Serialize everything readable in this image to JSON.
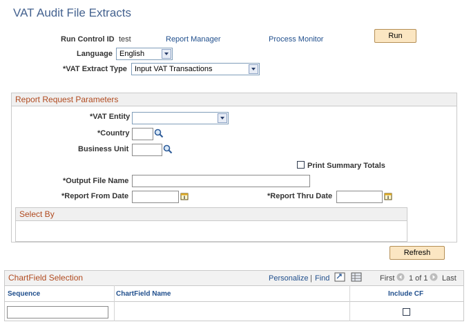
{
  "page": {
    "title": "VAT Audit File Extracts"
  },
  "header": {
    "run_control_label": "Run Control ID",
    "run_control_value": "test",
    "report_manager": "Report Manager",
    "process_monitor": "Process Monitor",
    "run_label": "Run",
    "language_label": "Language",
    "language_value": "English",
    "extract_type_label": "*VAT Extract Type",
    "extract_type_value": "Input VAT Transactions"
  },
  "params": {
    "title": "Report Request Parameters",
    "vat_entity_label": "*VAT Entity",
    "vat_entity_value": "",
    "country_label": "*Country",
    "business_unit_label": "Business Unit",
    "print_summary_label": "Print Summary Totals",
    "print_summary_checked": false,
    "output_file_label": "*Output File Name",
    "from_date_label": "*Report From Date",
    "thru_date_label": "*Report Thru Date",
    "select_by_title": "Select By",
    "refresh_label": "Refresh"
  },
  "chartfield": {
    "title": "ChartField Selection",
    "personalize": "Personalize",
    "separator": "|",
    "find": "Find",
    "first": "First",
    "page_info": "1 of 1",
    "last": "Last",
    "columns": [
      "Sequence",
      "ChartField Name",
      "Include CF"
    ],
    "rows": [
      {
        "sequence": "",
        "chartfield_name": "",
        "include_cf": false
      }
    ]
  }
}
